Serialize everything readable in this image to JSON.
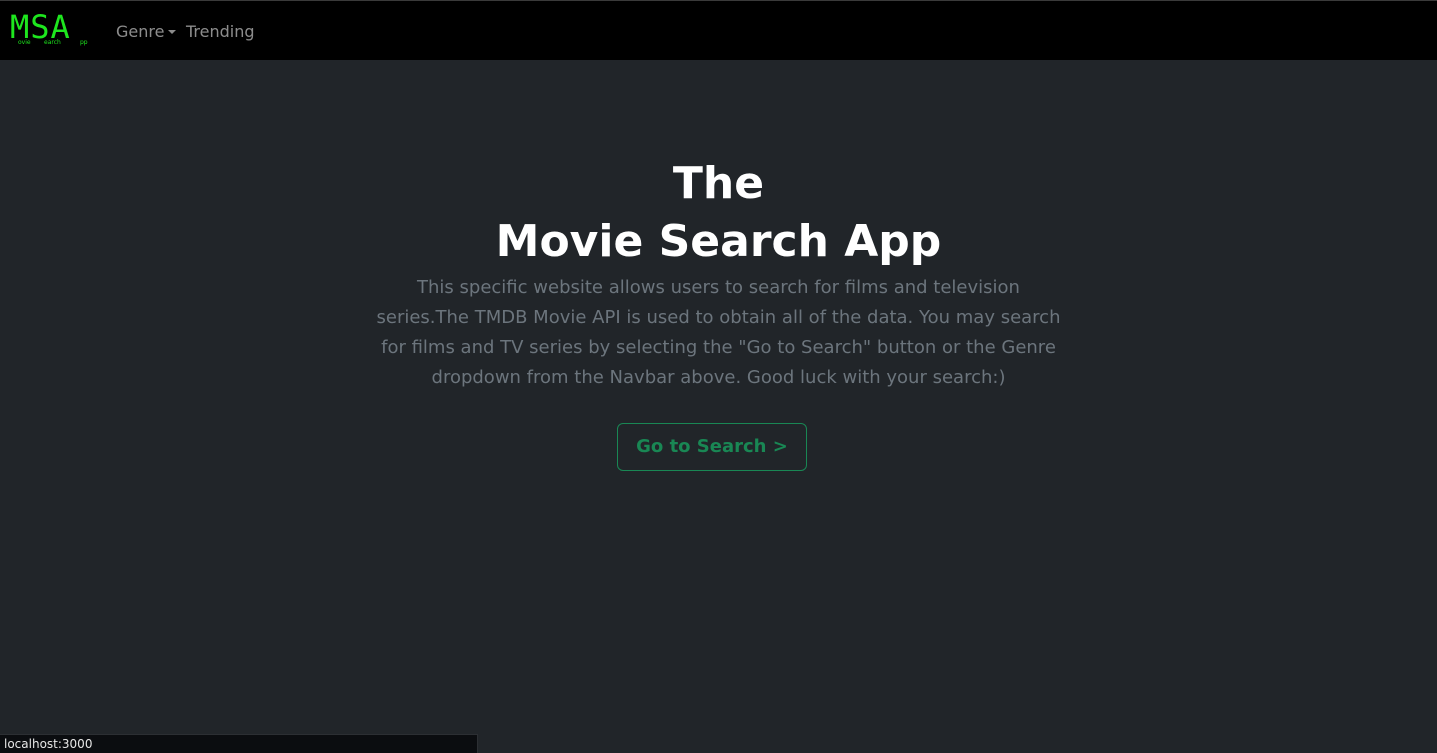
{
  "navbar": {
    "brand": {
      "big": "MSA",
      "small_1": "ovie",
      "small_2": "earch",
      "small_3": "pp"
    },
    "links": [
      {
        "label": "Genre",
        "has_dropdown": true
      },
      {
        "label": "Trending",
        "has_dropdown": false
      }
    ]
  },
  "hero": {
    "title_line_1": "The",
    "title_line_2": "Movie Search App",
    "description": "This specific website allows users to search for films and television series.The TMDB Movie API is used to obtain all of the data. You may search for films and TV series by selecting the \"Go to Search\" button or the Genre dropdown from the Navbar above. Good luck with your search:)",
    "button_label": "Go to Search >"
  },
  "status_bar": {
    "url": "localhost:3000"
  },
  "colors": {
    "background": "#212529",
    "navbar": "#000000",
    "brand_green": "#1ee61e",
    "button_green": "#198754",
    "muted_text": "#6c757d"
  }
}
